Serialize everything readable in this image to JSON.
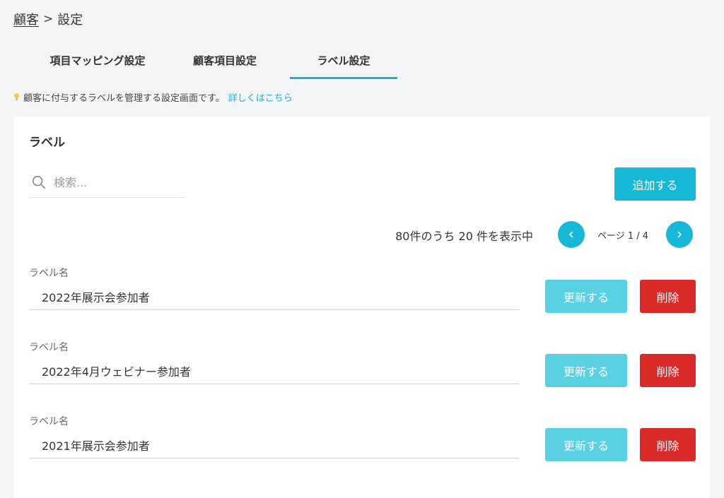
{
  "breadcrumb": {
    "parent": "顧客",
    "separator": ">",
    "current": "設定"
  },
  "tabs": [
    {
      "label": "項目マッピング設定",
      "active": false
    },
    {
      "label": "顧客項目設定",
      "active": false
    },
    {
      "label": "ラベル設定",
      "active": true
    }
  ],
  "info": {
    "icon": "lightbulb-icon",
    "text": "顧客に付与するラベルを管理する設定画面です。",
    "link": "詳しくはこちら"
  },
  "card": {
    "title": "ラベル"
  },
  "search": {
    "icon": "search-icon",
    "placeholder": "検索...",
    "value": ""
  },
  "add_button": {
    "label": "追加する"
  },
  "pagination": {
    "summary": "80件のうち 20 件を表示中",
    "page_label": "ページ 1 / 4",
    "prev_icon": "chevron-left-icon",
    "next_icon": "chevron-right-icon"
  },
  "labels": [
    {
      "caption": "ラベル名",
      "value": "2022年展示会参加者",
      "update_label": "更新する",
      "delete_label": "削除"
    },
    {
      "caption": "ラベル名",
      "value": "2022年4月ウェビナー参加者",
      "update_label": "更新する",
      "delete_label": "削除"
    },
    {
      "caption": "ラベル名",
      "value": "2021年展示会参加者",
      "update_label": "更新する",
      "delete_label": "削除"
    }
  ],
  "colors": {
    "accent": "#17b8d6",
    "update": "#5ad1e3",
    "delete": "#da2a2a",
    "background": "#f3f4f6"
  }
}
